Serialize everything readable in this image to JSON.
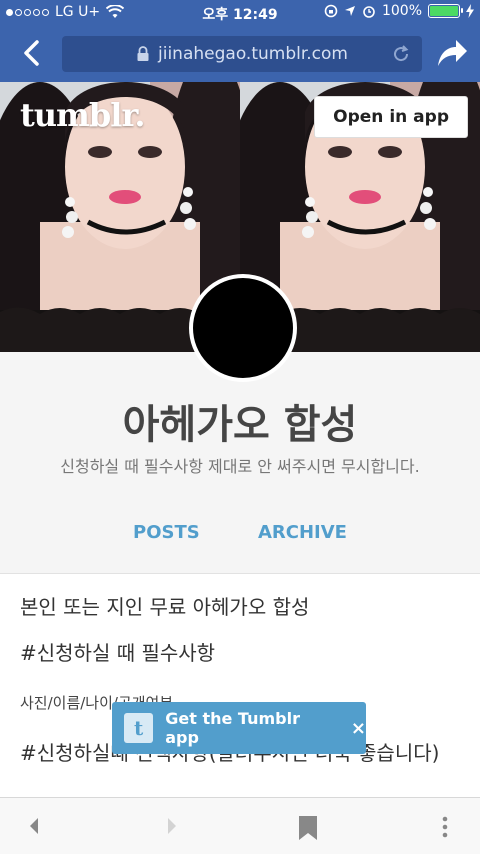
{
  "status_bar": {
    "carrier": "LG U+",
    "time": "오후 12:49",
    "battery": "100%",
    "battery_level": 1.0
  },
  "browser": {
    "url": "jiinahegao.tumblr.com",
    "icons": [
      "back-chevron-icon",
      "lock-icon",
      "reload-icon",
      "share-icon"
    ]
  },
  "header": {
    "logo": "tumblr.",
    "open_in_app": "Open in app"
  },
  "profile": {
    "title": "아헤가오 합성",
    "description": "신청하실 때 필수사항 제대로 안 써주시면 무시합니다.",
    "tabs": [
      "POSTS",
      "ARCHIVE"
    ]
  },
  "post": {
    "line1": "본인 또는 지인 무료 아헤가오 합성",
    "line2": "#신청하실 때 필수사항",
    "line3": "사진/이름/나이/공개여부",
    "line4": "#신청하실때 선택사항(알려주시면 더욱 좋습니다)"
  },
  "get_app": {
    "icon_letter": "t",
    "label": "Get the Tumblr app",
    "close": "×"
  },
  "colors": {
    "chrome_blue": "#3c64ad",
    "tumblr_blue": "#529ecc",
    "profile_bg": "#f5f5f5"
  }
}
